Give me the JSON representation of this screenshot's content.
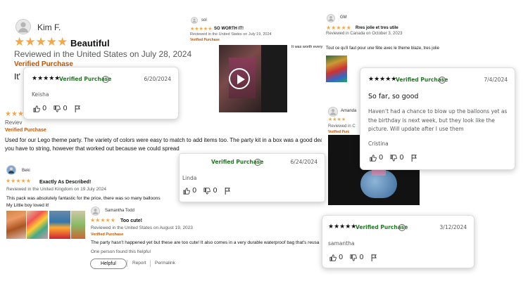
{
  "colors": {
    "star": "#f3a847",
    "verified_orange": "#c45500",
    "verified_green": "#1f7a1f"
  },
  "kim": {
    "name": "Kim F.",
    "stars": "★★★★★",
    "title": "Beautiful",
    "meta": "Reviewed in the United States on July 28, 2024",
    "verified": "Verified Purchase",
    "body_start": "It'"
  },
  "lego": {
    "stars": "★★★",
    "verified": "Verified Purchase",
    "body_line1": "Used for our Lego theme party. The variety of colors were easy to match to add items too. The party kit in a box was a good dea",
    "body_line2": "you have to string, however that worked out because we could spread"
  },
  "reviewed_stub": "Reviev",
  "sol": {
    "name": "sol",
    "stars": "★★★★★",
    "title": "SO WORTH IT!",
    "meta": "Reviewed in the United States on July 19, 2024",
    "verified": "Verified Purchase",
    "side_text": "It was worth every"
  },
  "gm": {
    "name": "GM",
    "stars": "★★★★★",
    "title": "Rres jolie et tres utile",
    "meta": "Reviewed in Canada on October 3, 2023",
    "body": "Tout ce qu'il faut pour une fête avec le theme blaze, tres jolie"
  },
  "amanda": {
    "name": "Amanda",
    "stars": "★★★★",
    "meta_stub": "Reviewed in C",
    "verified_stub": "Verified Purc"
  },
  "keisha": {
    "stars": "★★★★★",
    "verified": "Verified Purchase",
    "date": "6/20/2024",
    "name": "Keisha",
    "up": "0",
    "down": "0"
  },
  "cristina": {
    "stars": "★★★★★",
    "verified": "Verified Purchase",
    "date": "7/4/2024",
    "title": "So far, so good",
    "body": "Haven't had a chance to blow up the balloons yet as the birthday is next week, but they look like the picture. Will update after I use them",
    "name": "Cristina",
    "up": "0",
    "down": "0"
  },
  "linda": {
    "verified": "Verified Purchase",
    "date": "6/24/2024",
    "name": "Linda",
    "up": "0",
    "down": "0"
  },
  "beki": {
    "name": "Beki",
    "stars": "★★★★★",
    "title": "Exactly As Described!",
    "meta": "Reviewed in the United Kingdom on 19 July 2024",
    "body_line1": "This pack was absolutely fantastic for the price, there was so many balloons",
    "body_line2": "My Little boy loved it!"
  },
  "samantha_todd": {
    "name": "Samantha Todd",
    "stars": "★★★★★",
    "title": "Too cute!",
    "meta": "Reviewed in the United States on August 19, 2023",
    "verified": "Verified Purchase",
    "body": "The party hasn't happened yet but these are too cute! It also comes in a very durable waterproof bag that's reusa",
    "helpful_count": "One person found this helpful",
    "helpful_btn": "Helpful",
    "report": "Report",
    "permalink": "Permalink"
  },
  "samantha": {
    "stars": "★★★★★",
    "verified": "Verified Purchase",
    "date": "3/12/2024",
    "name": "samantha",
    "up": "0",
    "down": "0"
  },
  "icons": [
    "user-avatar-icon",
    "play-icon",
    "thumbs-up-icon",
    "thumbs-down-icon",
    "flag-icon",
    "info-icon"
  ]
}
